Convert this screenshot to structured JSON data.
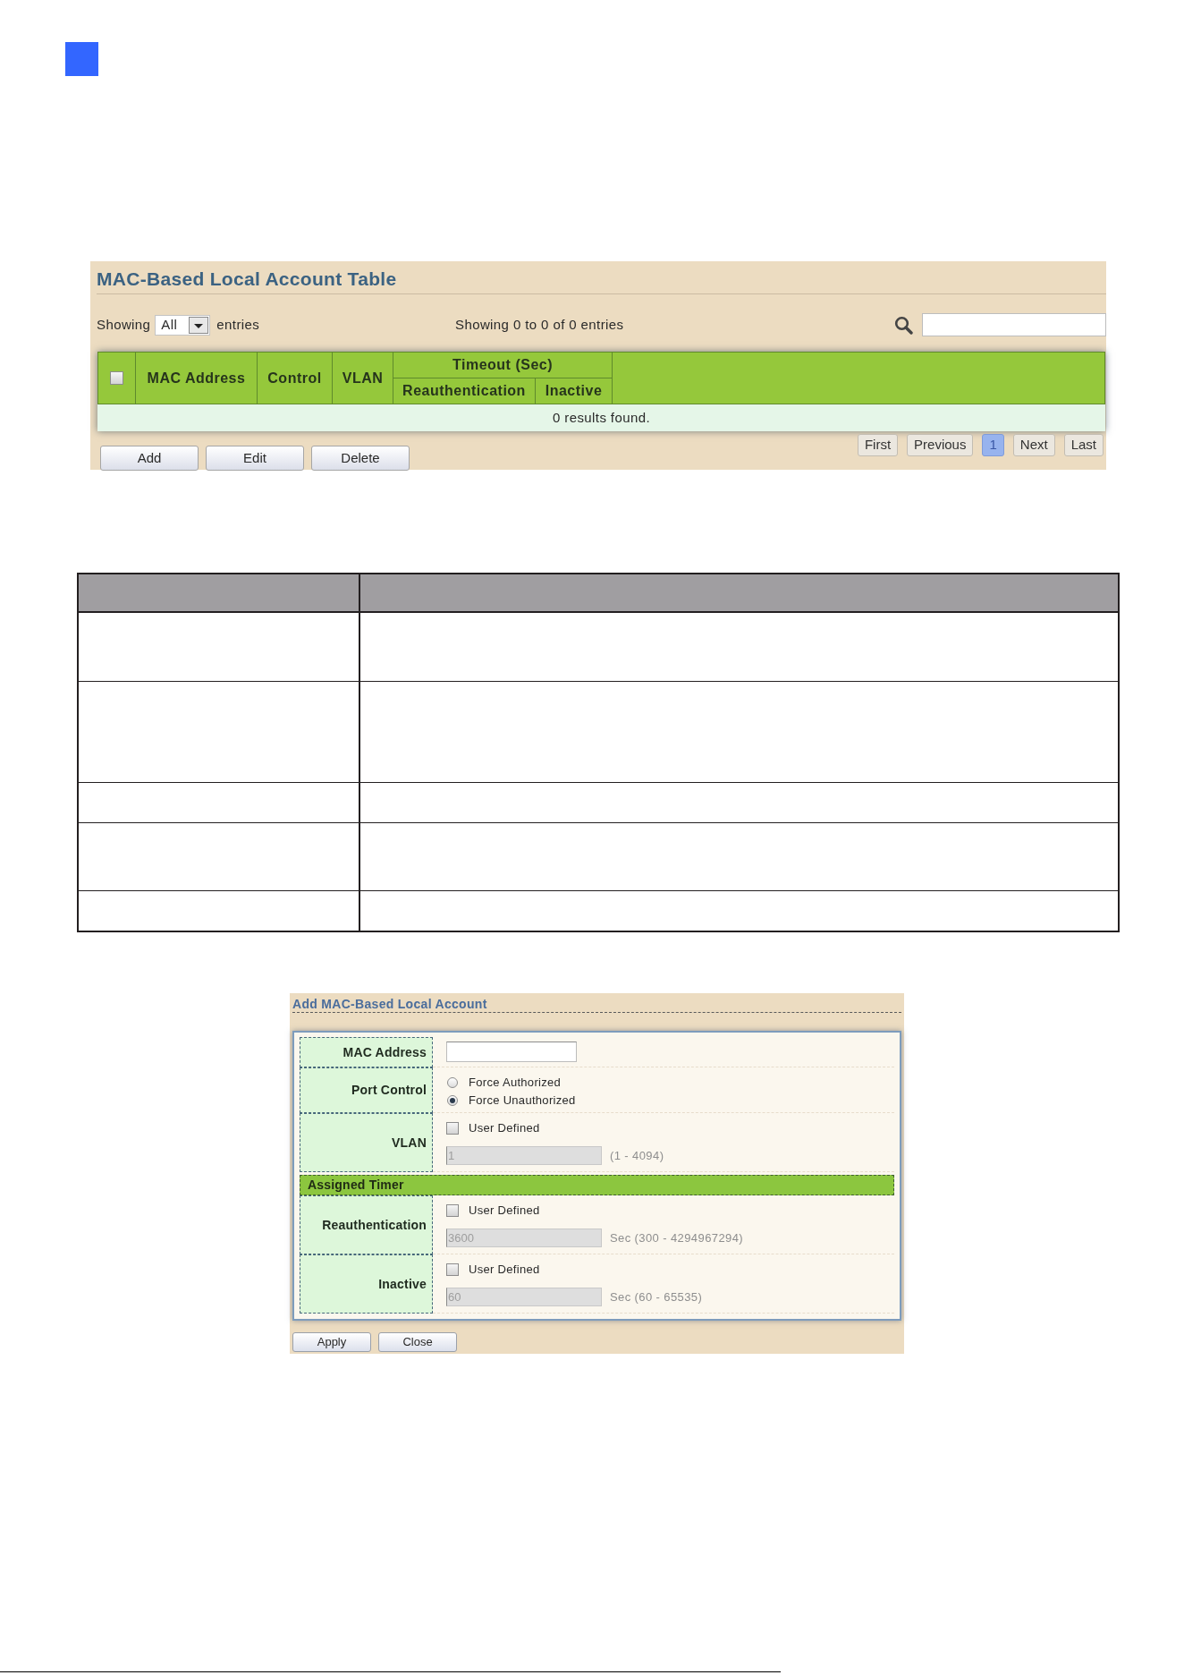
{
  "account_table_panel": {
    "title": "MAC-Based Local Account Table",
    "length_menu": {
      "label": "Showing",
      "value": "All",
      "suffix": "entries"
    },
    "info": "Showing 0 to 0 of 0 entries",
    "table": {
      "select_all": {
        "checked": false
      },
      "columns": [
        {
          "label": "MAC Address"
        },
        {
          "label": "Control"
        },
        {
          "label": "VLAN"
        },
        {
          "label": "Timeout (Sec)",
          "children": [
            {
              "label": "Reauthentication"
            },
            {
              "label": "Inactive"
            }
          ]
        }
      ],
      "empty_message": "0 results found."
    },
    "buttons": [
      {
        "label": "Add"
      },
      {
        "label": "Edit"
      },
      {
        "label": "Delete"
      }
    ],
    "pagination": [
      {
        "label": "First",
        "selected": false
      },
      {
        "label": "Previous",
        "selected": false
      },
      {
        "label": "1",
        "selected": true
      },
      {
        "label": "Next",
        "selected": false
      },
      {
        "label": "Last",
        "selected": false
      }
    ]
  },
  "add_account_form": {
    "title": "Add MAC-Based Local Account",
    "rows": [
      {
        "kind": "text_input",
        "label": "MAC Address"
      },
      {
        "kind": "radio",
        "label": "Port Control",
        "options": [
          {
            "label": "Force Authorized",
            "selected": false
          },
          {
            "label": "Force Unauthorized",
            "selected": true
          }
        ]
      },
      {
        "kind": "optional_value",
        "label": "VLAN",
        "checkbox": {
          "label": "User Defined",
          "checked": false
        },
        "value": "1",
        "disabled": true,
        "range": "(1 - 4094)"
      },
      {
        "kind": "section",
        "label": "Assigned Timer"
      },
      {
        "kind": "optional_value",
        "label": "Reauthentication",
        "checkbox": {
          "label": "User Defined",
          "checked": false
        },
        "value": "3600",
        "disabled": true,
        "range": "Sec (300 - 4294967294)"
      },
      {
        "kind": "optional_value",
        "label": "Inactive",
        "checkbox": {
          "label": "User Defined",
          "checked": false
        },
        "value": "60",
        "disabled": true,
        "range": "Sec (60 - 65535)"
      }
    ],
    "buttons": [
      {
        "label": "Apply"
      },
      {
        "label": "Close"
      }
    ]
  }
}
